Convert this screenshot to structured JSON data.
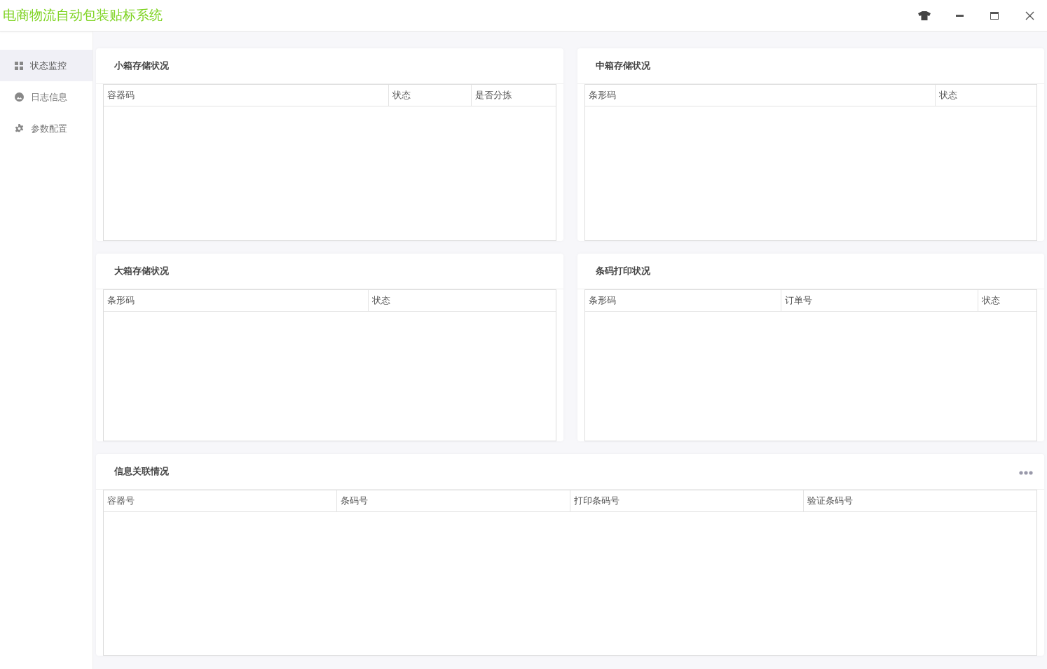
{
  "window": {
    "title": "电商物流自动包装贴标系统"
  },
  "sidebar": {
    "items": [
      {
        "label": "状态监控",
        "selected": true
      },
      {
        "label": "日志信息",
        "selected": false
      },
      {
        "label": "参数配置",
        "selected": false
      }
    ]
  },
  "panels": [
    {
      "title": "小箱存储状况",
      "columns": [
        "容器码",
        "状态",
        "是否分拣"
      ]
    },
    {
      "title": "中箱存储状况",
      "columns": [
        "条形码",
        "状态"
      ]
    },
    {
      "title": "大箱存储状况",
      "columns": [
        "条形码",
        "状态"
      ]
    },
    {
      "title": "条码打印状况",
      "columns": [
        "条形码",
        "订单号",
        "状态"
      ]
    },
    {
      "title": "信息关联情况",
      "more": true,
      "columns": [
        "容器号",
        "条码号",
        "打印条码号",
        "验证条码号"
      ]
    }
  ]
}
